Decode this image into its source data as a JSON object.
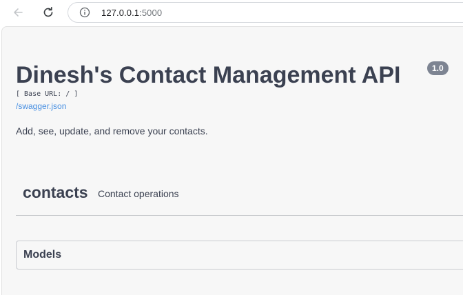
{
  "browser": {
    "url_host": "127.0.0.1",
    "url_port": ":5000"
  },
  "info": {
    "title": "Dinesh's Contact Management API",
    "version": "1.0",
    "base_url": "[ Base URL: / ]",
    "spec_link": "/swagger.json",
    "description": "Add, see, update, and remove your contacts."
  },
  "tags": [
    {
      "name": "contacts",
      "description": "Contact operations"
    }
  ],
  "models": {
    "title": "Models"
  },
  "colors": {
    "text": "#3b4151",
    "link": "#4990e2",
    "badge": "#7d8492",
    "page_bg": "#f7f7f7"
  }
}
